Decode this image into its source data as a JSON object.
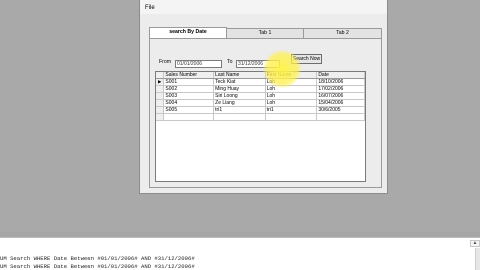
{
  "window": {
    "menu": {
      "file_label": "File"
    },
    "tabs": [
      {
        "label": "search By Date",
        "active": true
      },
      {
        "label": "Tab 1",
        "active": false
      },
      {
        "label": "Tab 2",
        "active": false
      }
    ]
  },
  "search": {
    "from_label": "From",
    "from_value": "01/01/2006",
    "to_label": "To",
    "to_value": "31/12/2006",
    "button_label": "Search Now"
  },
  "grid": {
    "columns": [
      "Sales Number",
      "Last Name",
      "First Name",
      "Date"
    ],
    "rows": [
      {
        "selected": true,
        "cells": [
          "S001",
          "Teck Kiat",
          "Loh",
          "18/10/2006"
        ]
      },
      {
        "selected": false,
        "cells": [
          "S002",
          "Ming Huay",
          "Loh",
          "17/02/2006"
        ]
      },
      {
        "selected": false,
        "cells": [
          "S003",
          "Siri Loong",
          "Loh",
          "16/07/2006"
        ]
      },
      {
        "selected": false,
        "cells": [
          "S004",
          "Ze Liang",
          "Loh",
          "15/04/2006"
        ]
      },
      {
        "selected": false,
        "cells": [
          "S005",
          "tri1",
          "tri1",
          "30/6/2005"
        ]
      }
    ],
    "row_pointer_glyph": "▶"
  },
  "console": {
    "lines": [
      "UM Search WHERE Date Between #01/01/2006# AND #31/12/2006#",
      "UM Search WHERE Date Between #01/01/2006# AND #31/12/2006#"
    ],
    "toolbar_glyph": "▲"
  },
  "colors": {
    "highlight": "#fff046",
    "window_bg": "#ececec",
    "desktop_bg": "#a9a9a9"
  }
}
